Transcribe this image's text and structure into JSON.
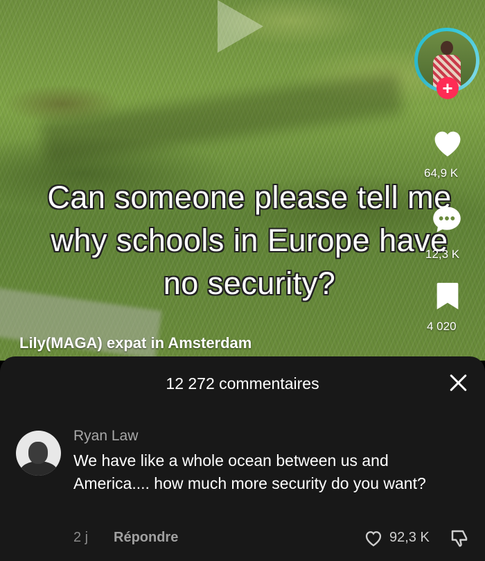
{
  "video": {
    "caption": "Can someone please tell me why schools in Europe have no security?",
    "username": "Lily(MAGA) expat in Amsterdam",
    "likes": "64,9 K",
    "comments": "12,3 K",
    "bookmarks": "4 020",
    "follow_symbol": "+"
  },
  "comments_sheet": {
    "title": "12 272 commentaires",
    "comment": {
      "author": "Ryan Law",
      "text": "We have like a whole ocean between us and America.... how much more security do you want?",
      "time": "2 j",
      "reply_label": "Répondre",
      "likes": "92,3 K"
    }
  },
  "colors": {
    "accent": "#fe2c55",
    "avatar_ring": "#30c4d8",
    "sheet_bg": "#181818"
  },
  "icons": [
    "heart-icon",
    "comment-bubble-icon",
    "bookmark-icon",
    "close-icon",
    "like-outline-icon",
    "dislike-icon",
    "plus-icon"
  ]
}
